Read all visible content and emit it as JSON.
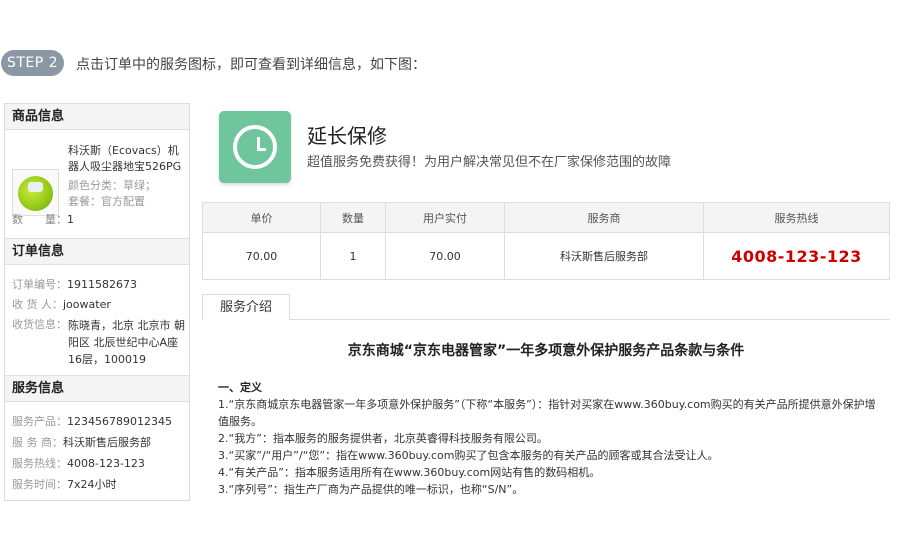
{
  "step": {
    "badge": "STEP 2",
    "text": "点击订单中的服务图标，即可查看到详细信息，如下图："
  },
  "product_info": {
    "heading": "商品信息",
    "image_icon": "robot-vacuum-image",
    "name": "科沃斯（Ecovacs）机器人吸尘器地宝526PG",
    "color": "颜色分类：草绿；",
    "package": "套餐：官方配置",
    "quantity_label": "数　　量：",
    "quantity_value": "1"
  },
  "order_info": {
    "heading": "订单信息",
    "order_no_label": "订单编号：",
    "order_no": "1911582673",
    "receiver_label": "收 货 人：",
    "receiver": "joowater",
    "address_label": "收货信息：",
    "address": "陈晓青，北京 北京市 朝阳区 北辰世纪中心A座16层，100019"
  },
  "service_info": {
    "heading": "服务信息",
    "product_label": "服务产品：",
    "product": "123456789012345",
    "provider_label": "服 务 商：",
    "provider": "科沃斯售后服务部",
    "hotline_label": "服务热线：",
    "hotline": "4008-123-123",
    "time_label": "服务时间：",
    "time": "7x24小时"
  },
  "service_header": {
    "icon": "clock-icon",
    "icon_color": "#6fc59c",
    "title": "延长保修",
    "description": "超值服务免费获得！为用户解决常见但不在厂家保修范围的故障"
  },
  "detail_table": {
    "columns": [
      "单价",
      "数量",
      "用户实付",
      "服务商",
      "服务热线"
    ],
    "row": [
      "70.00",
      "1",
      "70.00",
      "科沃斯售后服务部",
      "4008-123-123"
    ],
    "hotline_color": "#cc0000"
  },
  "tab": {
    "label": "服务介绍"
  },
  "terms": {
    "title": "京东商城“京东电器管家”一年多项意外保护服务产品条款与条件",
    "section_heading": "一、定义",
    "items": [
      "1.“京东商城京东电器管家一年多项意外保护服务”（下称“本服务”）：指针对买家在www.360buy.com购买的有关产品所提供意外保护增值服务。",
      "2.“我方”：指本服务的服务提供者，北京英睿得科技服务有限公司。",
      "3.“买家”/“用户”/“您”：指在www.360buy.com购买了包含本服务的有关产品的顾客或其合法受让人。",
      "4.“有关产品”：指本服务适用所有在www.360buy.com网站有售的数码相机。",
      "3.“序列号”：指生产厂商为产品提供的唯一标识，也称“S/N”。"
    ]
  }
}
